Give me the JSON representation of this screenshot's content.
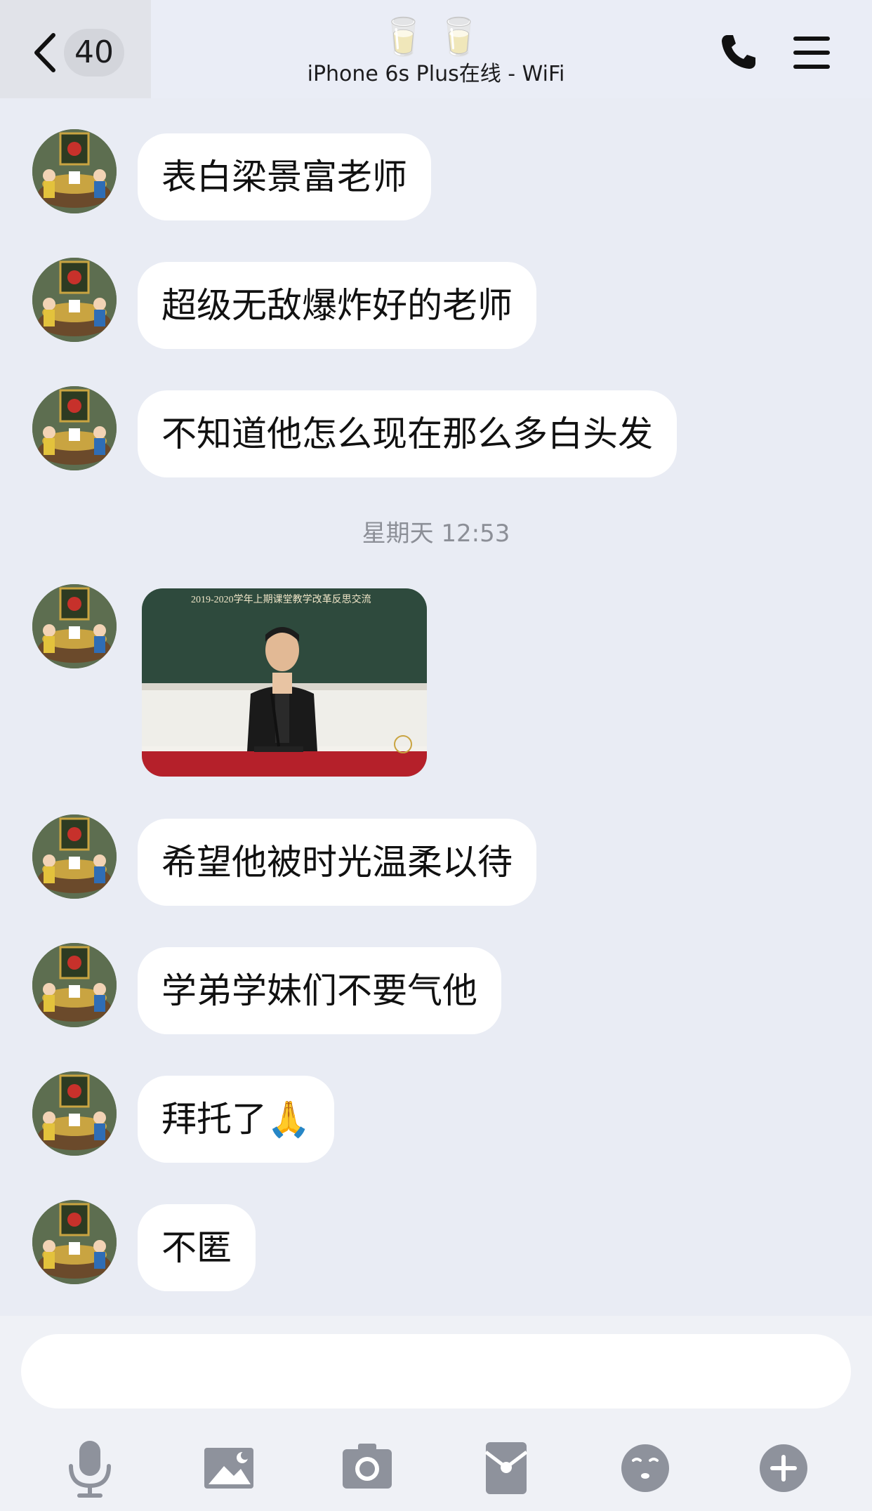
{
  "header": {
    "unread_count": "40",
    "title_emoji": "🥛🥛",
    "status": "iPhone 6s Plus在线 - WiFi"
  },
  "messages": [
    {
      "type": "text",
      "text": "表白梁景富老师"
    },
    {
      "type": "text",
      "text": "超级无敌爆炸好的老师"
    },
    {
      "type": "text",
      "text": "不知道他怎么现在那么多白头发"
    },
    {
      "type": "timestamp",
      "text": "星期天 12:53"
    },
    {
      "type": "image",
      "caption": "2019-2020学年上期课堂教学改革反思交流"
    },
    {
      "type": "text",
      "text": "希望他被时光温柔以待"
    },
    {
      "type": "text",
      "text": "学弟学妹们不要气他"
    },
    {
      "type": "text",
      "text": "拜托了🙏"
    },
    {
      "type": "text",
      "text": "不匿"
    }
  ],
  "composer": {
    "input_value": "",
    "tools": [
      "microphone-icon",
      "image-icon",
      "camera-icon",
      "red-packet-icon",
      "emoji-icon",
      "plus-icon"
    ]
  },
  "colors": {
    "background": "#e9ecf4",
    "bubble": "#ffffff",
    "icon_gray": "#8e929c",
    "timestamp": "#8c8f97"
  }
}
